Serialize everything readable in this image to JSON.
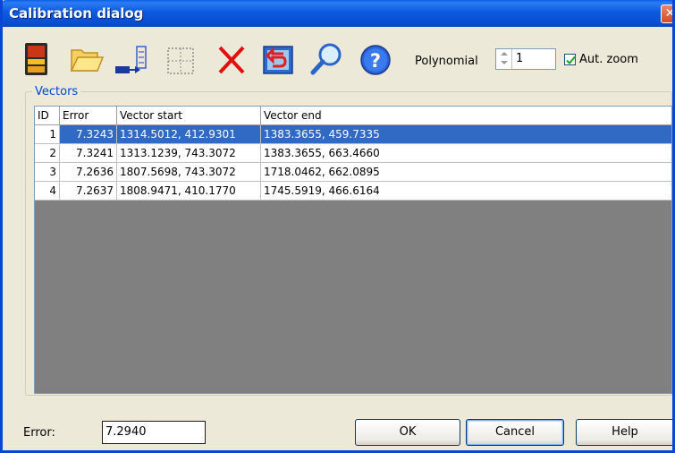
{
  "window": {
    "title": "Calibration dialog",
    "close_glyph": "✕"
  },
  "toolbar": {
    "icons": [
      "save-icon",
      "open-folder-icon",
      "export-icon",
      "grid-points-icon",
      "delete-icon",
      "undo-icon",
      "zoom-icon",
      "help-icon"
    ],
    "polynomial_label": "Polynomial",
    "polynomial_value": "1",
    "aut_zoom_label": "Aut. zoom",
    "aut_zoom_checked": true
  },
  "vectors": {
    "group_title": "Vectors",
    "columns": [
      "ID",
      "Error",
      "Vector start",
      "Vector end"
    ],
    "rows": [
      {
        "id": "1",
        "error": "7.3243",
        "start": "1314.5012, 412.9301",
        "end": "1383.3655, 459.7335",
        "selected": true
      },
      {
        "id": "2",
        "error": "7.3241",
        "start": "1313.1239, 743.3072",
        "end": "1383.3655, 663.4660",
        "selected": false
      },
      {
        "id": "3",
        "error": "7.2636",
        "start": "1807.5698, 743.3072",
        "end": "1718.0462, 662.0895",
        "selected": false
      },
      {
        "id": "4",
        "error": "7.2637",
        "start": "1808.9471, 410.1770",
        "end": "1745.5919, 466.6164",
        "selected": false
      }
    ]
  },
  "footer": {
    "error_label": "Error:",
    "error_value": "7.2940",
    "ok_label": "OK",
    "cancel_label": "Cancel",
    "help_label": "Help"
  },
  "colors": {
    "title_bar": "#0a5fe8",
    "selection": "#316ac5",
    "group_title": "#0046d5",
    "grid_background": "#808080"
  }
}
